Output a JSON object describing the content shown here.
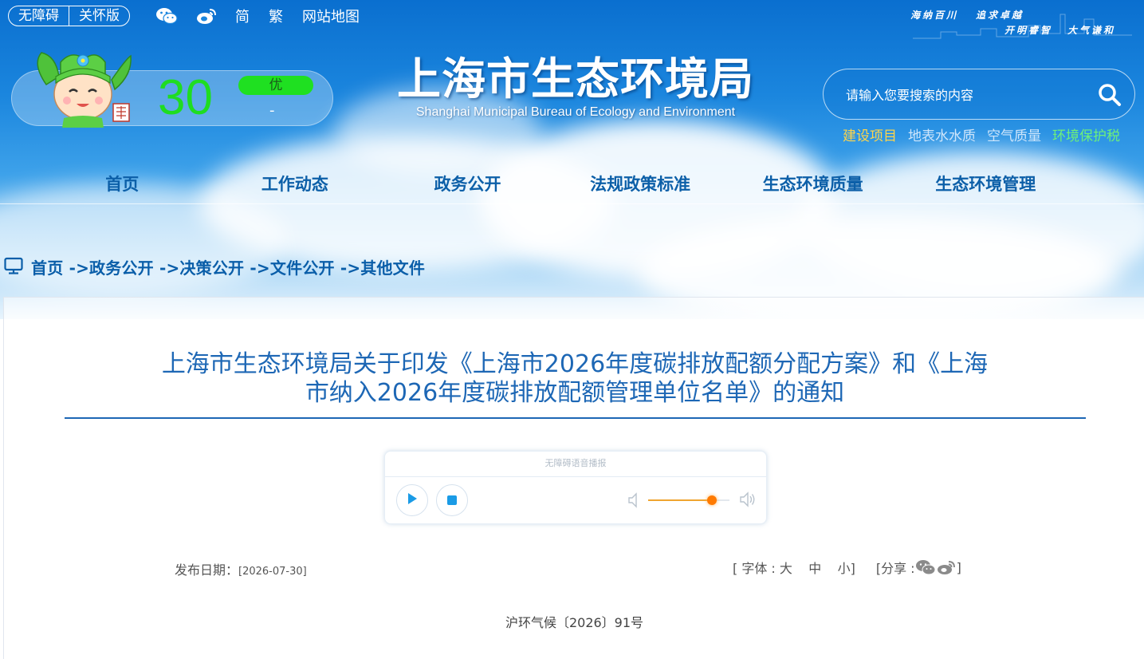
{
  "top_bar": {
    "accessibility_label": "无障碍",
    "care_mode_label": "关怀版",
    "icons": [
      "wechat-icon",
      "weibo-icon"
    ],
    "links": [
      "简",
      "繁",
      "网站地图"
    ]
  },
  "slogan": {
    "line1a": "海纳百川",
    "line1b": "追求卓越",
    "line2a": "开明睿智",
    "line2b": "大气谦和"
  },
  "aqi": {
    "value": "30",
    "level": "优",
    "sub": "-"
  },
  "site": {
    "title_cn": "上海市生态环境局",
    "title_en": "Shanghai Municipal Bureau of Ecology and Environment"
  },
  "search": {
    "placeholder": "请输入您要搜索的内容"
  },
  "quick_links": [
    {
      "label": "建设项目",
      "color": "#ffd54a"
    },
    {
      "label": "地表水水质",
      "color": "#cfe6fb"
    },
    {
      "label": "空气质量",
      "color": "#cfe6fb"
    },
    {
      "label": "环境保护税",
      "color": "#6ef07a"
    }
  ],
  "nav": [
    "首页",
    "工作动态",
    "政务公开",
    "法规政策标准",
    "生态环境质量",
    "生态环境管理"
  ],
  "breadcrumb": "首页 ->政务公开 ->决策公开 ->文件公开 ->其他文件",
  "article": {
    "title_line1": "上海市生态环境局关于印发《上海市2026年度碳排放配额分配方案》和《上海",
    "title_line2": "市纳入2026年度碳排放配额管理单位名单》的通知",
    "player_label": "无障碍语音播报",
    "volume": 0.78,
    "date_label": "发布日期：",
    "date_value": "[2026-07-30]",
    "font_size_label": "[ 字体 : 大    中    小]",
    "share_label": "[分享 :",
    "share_end": "]",
    "doc_number": "沪环气候〔2026〕91号"
  },
  "colors": {
    "brand_blue": "#0c5fa8",
    "title_blue": "#1d67b5",
    "aqi_green": "#1fdd21"
  }
}
